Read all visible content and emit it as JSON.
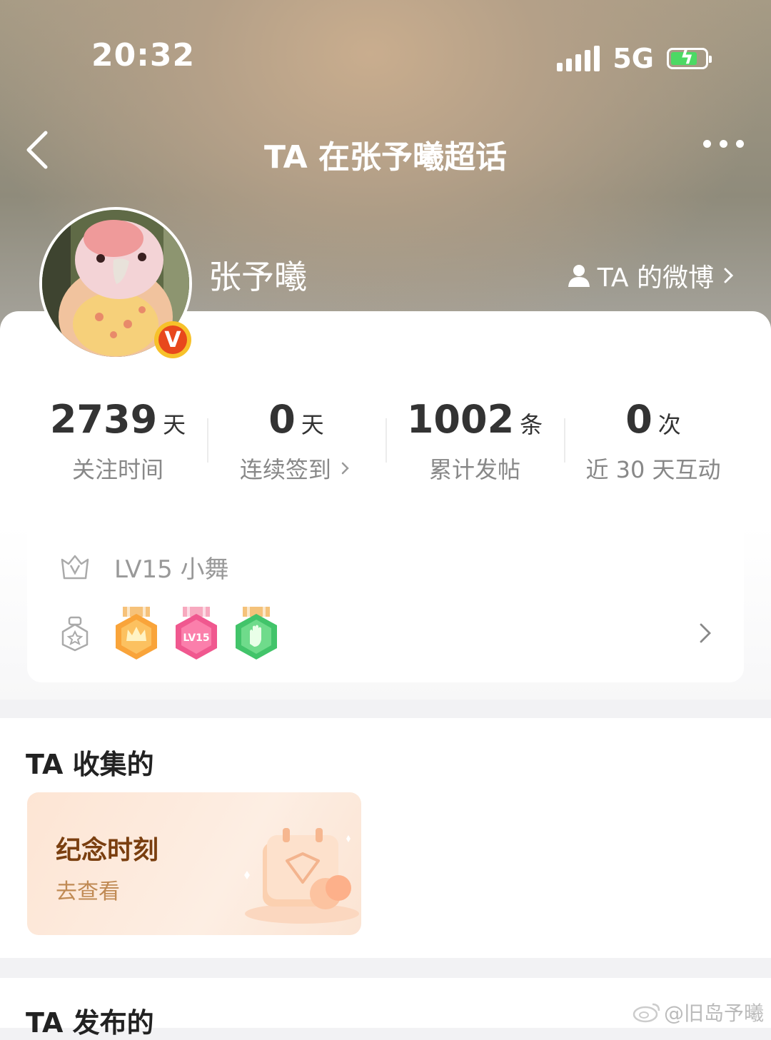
{
  "status_bar": {
    "time": "20:32",
    "network": "5G"
  },
  "nav": {
    "title": "TA 在张予曦超话"
  },
  "profile": {
    "name": "张予曦",
    "weibo_link": "TA 的微博",
    "verified_badge": "V"
  },
  "stats": [
    {
      "value": "2739",
      "unit": "天",
      "label": "关注时间"
    },
    {
      "value": "0",
      "unit": "天",
      "label": "连续签到"
    },
    {
      "value": "1002",
      "unit": "条",
      "label": "累计发帖"
    },
    {
      "value": "0",
      "unit": "次",
      "label": "近 30 天互动"
    }
  ],
  "level": {
    "text": "LV15 小舞"
  },
  "medals": [
    {
      "name": "crown-medal",
      "color": "#f9a43a"
    },
    {
      "name": "lv15-medal",
      "label": "LV15",
      "color": "#f0588f"
    },
    {
      "name": "hand-medal",
      "color": "#42c46a"
    }
  ],
  "collect": {
    "title": "TA 收集的",
    "card_title": "纪念时刻",
    "card_action": "去查看"
  },
  "posted": {
    "title": "TA 发布的"
  },
  "watermark": "@旧岛予曦",
  "colors": {
    "accent_badge": "#e8481c",
    "battery": "#4cd964"
  }
}
